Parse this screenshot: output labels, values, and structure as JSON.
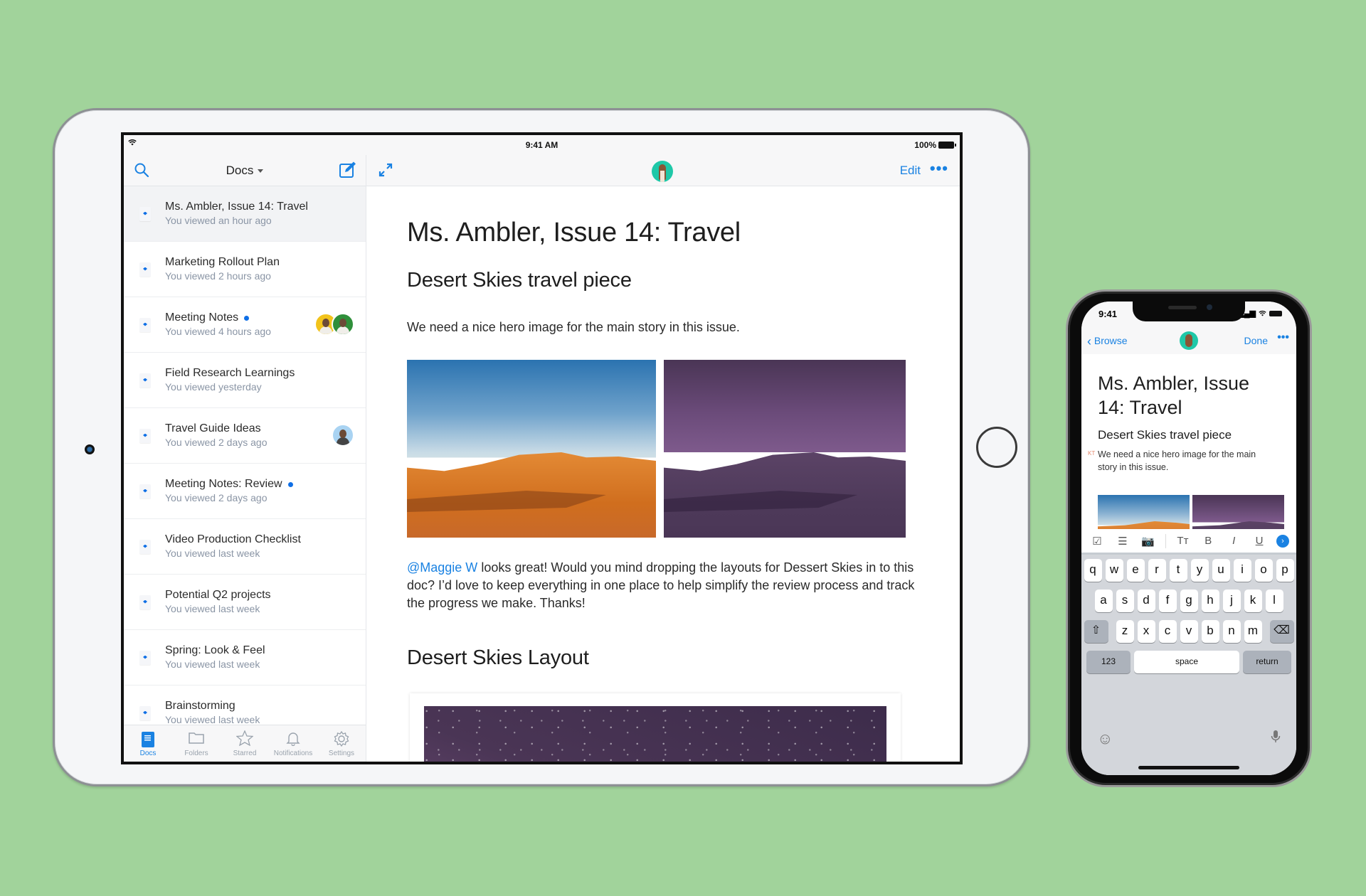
{
  "background_color": "#a1d39b",
  "accent_color": "#1a82e2",
  "ipad": {
    "status": {
      "time": "9:41 AM",
      "battery": "100%",
      "wifi_icon": "wifi-icon",
      "battery_icon": "battery-icon"
    },
    "sidebar": {
      "title": "Docs",
      "search_icon": "search-icon",
      "compose_icon": "compose-icon",
      "docs": [
        {
          "title": "Ms. Ambler, Issue 14: Travel",
          "subtitle": "You viewed an hour ago",
          "active": true,
          "unread": false,
          "avatars": []
        },
        {
          "title": "Marketing Rollout Plan",
          "subtitle": "You viewed 2 hours ago",
          "active": false,
          "unread": false,
          "avatars": []
        },
        {
          "title": "Meeting Notes",
          "subtitle": "You viewed 4 hours ago",
          "active": false,
          "unread": true,
          "avatars": [
            "yellow",
            "green"
          ]
        },
        {
          "title": "Field Research Learnings",
          "subtitle": "You viewed yesterday",
          "active": false,
          "unread": false,
          "avatars": []
        },
        {
          "title": "Travel Guide Ideas",
          "subtitle": "You viewed 2 days ago",
          "active": false,
          "unread": false,
          "avatars": [
            "blue"
          ]
        },
        {
          "title": "Meeting Notes: Review",
          "subtitle": "You viewed 2 days ago",
          "active": false,
          "unread": true,
          "avatars": []
        },
        {
          "title": "Video Production Checklist",
          "subtitle": "You viewed last week",
          "active": false,
          "unread": false,
          "avatars": []
        },
        {
          "title": "Potential Q2 projects",
          "subtitle": "You viewed last week",
          "active": false,
          "unread": false,
          "avatars": []
        },
        {
          "title": "Spring: Look & Feel",
          "subtitle": "You viewed last week",
          "active": false,
          "unread": false,
          "avatars": []
        },
        {
          "title": "Brainstorming",
          "subtitle": "You viewed last week",
          "active": false,
          "unread": false,
          "avatars": []
        }
      ],
      "tabs": [
        {
          "label": "Docs",
          "icon": "docs-icon",
          "active": true
        },
        {
          "label": "Folders",
          "icon": "folder-icon",
          "active": false
        },
        {
          "label": "Starred",
          "icon": "star-icon",
          "active": false
        },
        {
          "label": "Notifications",
          "icon": "bell-icon",
          "active": false
        },
        {
          "label": "Settings",
          "icon": "gear-icon",
          "active": false
        }
      ]
    },
    "main": {
      "expand_icon": "expand-icon",
      "edit_label": "Edit",
      "more_label": "•••",
      "doc_title": "Ms. Ambler, Issue 14: Travel",
      "section1_heading": "Desert Skies travel piece",
      "section1_text": "We need a nice hero image for the main story in this issue.",
      "images": [
        "desert-day-image",
        "desert-night-image"
      ],
      "mention": "@Maggie W",
      "comment_text": " looks great! Would you mind dropping the layouts for Dessert Skies in to this doc? I’d love to keep everything in one place to help simplify the review process and track the progress we make. Thanks!",
      "section2_heading": "Desert Skies Layout"
    }
  },
  "iphone": {
    "status": {
      "time": "9:41",
      "signal": "▂▄▆"
    },
    "nav": {
      "back_label": "Browse",
      "done_label": "Done",
      "more_label": "•••"
    },
    "doc_title": "Ms. Ambler, Issue 14: Travel",
    "section_heading": "Desert Skies travel piece",
    "author_initials": "KT",
    "section_text": "We need a nice hero image for the main story in this issue.",
    "toolbar": [
      {
        "name": "checkbox-icon",
        "glyph": "☑"
      },
      {
        "name": "list-icon",
        "glyph": "☰"
      },
      {
        "name": "camera-icon",
        "glyph": "📷"
      },
      {
        "name": "text-size-icon",
        "glyph": "Tт"
      },
      {
        "name": "bold-icon",
        "glyph": "B"
      },
      {
        "name": "italic-icon",
        "glyph": "I"
      },
      {
        "name": "underline-icon",
        "glyph": "U"
      }
    ],
    "keyboard": {
      "row1": [
        "q",
        "w",
        "e",
        "r",
        "t",
        "y",
        "u",
        "i",
        "o",
        "p"
      ],
      "row2": [
        "a",
        "s",
        "d",
        "f",
        "g",
        "h",
        "j",
        "k",
        "l"
      ],
      "row3": [
        "z",
        "x",
        "c",
        "v",
        "b",
        "n",
        "m"
      ],
      "numbers_label": "123",
      "space_label": "space",
      "return_label": "return",
      "shift_glyph": "⇧",
      "delete_glyph": "⌫",
      "emoji_glyph": "☺",
      "mic_glyph": "🎙"
    }
  }
}
